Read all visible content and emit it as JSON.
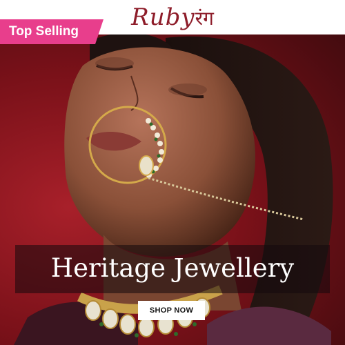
{
  "brand": {
    "name_latin": "Ruby",
    "name_devanagari": "रंग",
    "color": "#8e1d2a"
  },
  "badge": {
    "label": "Top Selling",
    "color": "#e83e8c"
  },
  "headline": "Heritage Jewellery",
  "cta": {
    "label": "SHOP NOW"
  },
  "colors": {
    "background": "#7a1119",
    "cta_bg": "#ffffff"
  }
}
